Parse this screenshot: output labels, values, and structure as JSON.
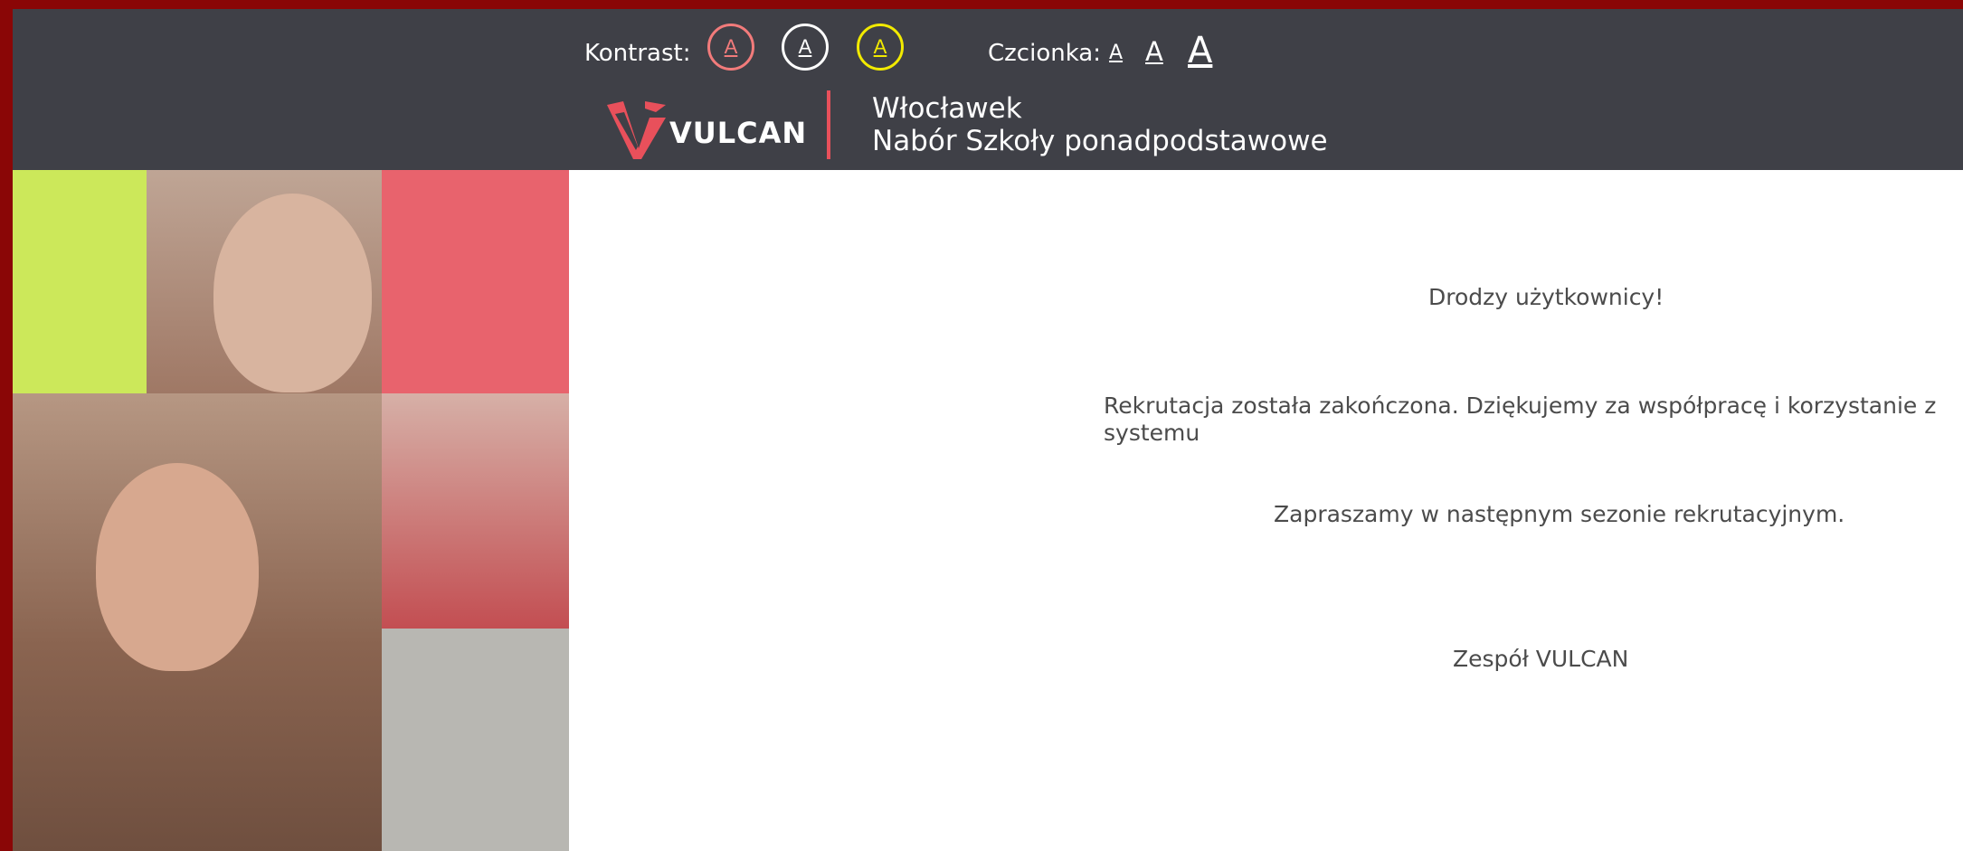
{
  "toolbar": {
    "contrast_label": "Kontrast:",
    "contrast_options": [
      "A",
      "A",
      "A"
    ],
    "font_label": "Czcionka:",
    "font_options": [
      "A",
      "A",
      "A"
    ]
  },
  "header": {
    "logo_text": "VULCAN",
    "city": "Włocławek",
    "subtitle": "Nabór Szkoły ponadpodstawowe"
  },
  "content": {
    "greeting": "Drodzy użytkownicy!",
    "message": "Rekrutacja została zakończona. Dziękujemy za współpracę i korzystanie z systemu",
    "invitation": "Zapraszamy w następnym sezonie rekrutacyjnym.",
    "signature": "Zespół VULCAN"
  },
  "colors": {
    "window_border": "#8a0606",
    "topbar": "#3f4047",
    "accent_red": "#e8505b",
    "contrast_red": "#f27b7b",
    "contrast_white": "#ffffff",
    "contrast_yellow": "#f2ea00",
    "photo_lime": "#cce85a",
    "photo_coral": "#e8636d",
    "photo_gray": "#b8b7b2",
    "text": "#4b4b4b"
  }
}
